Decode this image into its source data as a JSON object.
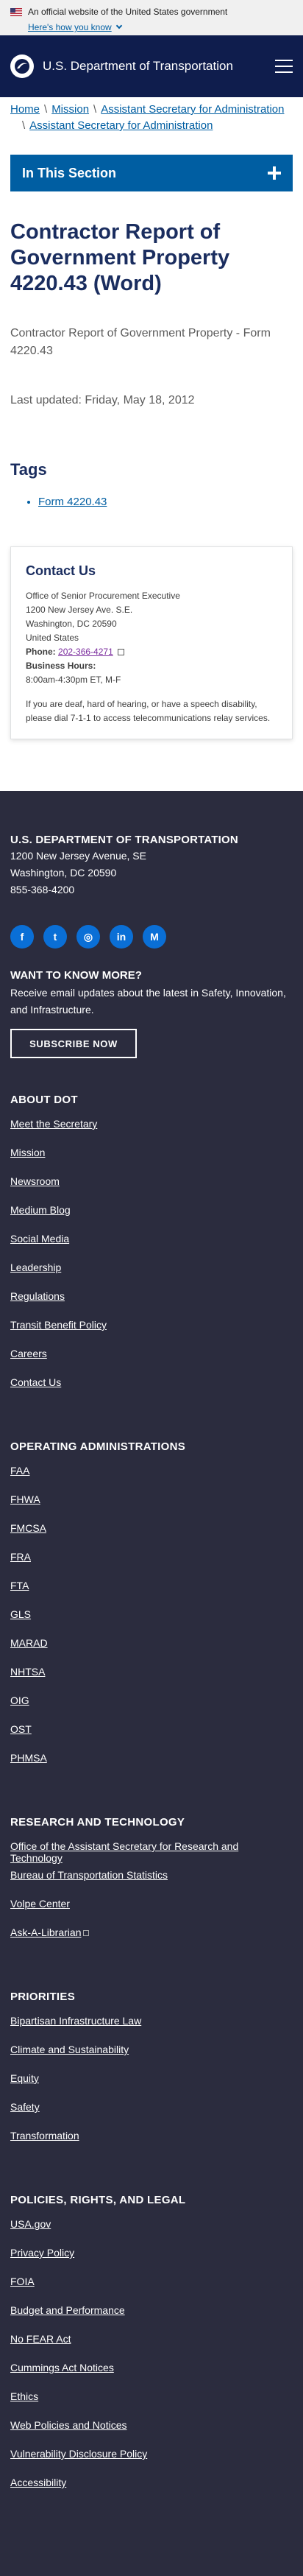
{
  "banner": {
    "official_text": "An official website of the United States government",
    "how_link": "Here's how you know"
  },
  "header": {
    "title": "U.S. Department of Transportation"
  },
  "breadcrumb": {
    "items": [
      "Home",
      "Mission",
      "Assistant Secretary for Administration",
      "Assistant Secretary for Administration"
    ]
  },
  "section_toggle": {
    "label": "In This Section"
  },
  "main": {
    "title": "Contractor Report of Government Property 4220.43 (Word)",
    "summary": "Contractor Report of Government Property - Form 4220.43",
    "last_updated": "Last updated: Friday, May 18, 2012",
    "tags_heading": "Tags",
    "tags": [
      "Form 4220.43"
    ]
  },
  "contact": {
    "heading": "Contact Us",
    "office": "Office of Senior Procurement Executive",
    "street": "1200 New Jersey Ave. S.E.",
    "city": "Washington, DC 20590",
    "country": "United States",
    "phone_label": "Phone:",
    "phone": "202-366-4271",
    "hours_label": "Business Hours:",
    "hours": "8:00am-4:30pm ET, M-F",
    "note": "If you are deaf, hard of hearing, or have a speech disability, please dial 7-1-1 to access telecommunications relay services."
  },
  "footer": {
    "org": "U.S. DEPARTMENT OF TRANSPORTATION",
    "address_line1": "1200 New Jersey Avenue, SE",
    "address_line2": "Washington, DC 20590",
    "phone": "855-368-4200",
    "socials": [
      {
        "name": "facebook-icon",
        "glyph": "f"
      },
      {
        "name": "twitter-icon",
        "glyph": "t"
      },
      {
        "name": "instagram-icon",
        "glyph": "◎"
      },
      {
        "name": "linkedin-icon",
        "glyph": "in"
      },
      {
        "name": "medium-icon",
        "glyph": "M"
      }
    ],
    "want_heading": "WANT TO KNOW MORE?",
    "want_text": "Receive email updates about the latest in Safety, Innovation, and Infrastructure.",
    "subscribe_label": "SUBSCRIBE NOW",
    "sections": [
      {
        "heading": "ABOUT DOT",
        "links": [
          "Meet the Secretary",
          "Mission",
          "Newsroom",
          "Medium Blog",
          "Social Media",
          "Leadership",
          "Regulations",
          "Transit Benefit Policy",
          "Careers",
          "Contact Us"
        ]
      },
      {
        "heading": "OPERATING ADMINISTRATIONS",
        "links": [
          "FAA",
          "FHWA",
          "FMCSA",
          "FRA",
          "FTA",
          "GLS",
          "MARAD",
          "NHTSA",
          "OIG",
          "OST",
          "PHMSA"
        ]
      },
      {
        "heading": "RESEARCH AND TECHNOLOGY",
        "links": [
          "Office of the Assistant Secretary for Research and Technology",
          "Bureau of Transportation Statistics",
          "Volpe Center",
          "Ask-A-Librarian"
        ]
      },
      {
        "heading": "PRIORITIES",
        "links": [
          "Bipartisan Infrastructure Law",
          "Climate and Sustainability",
          "Equity",
          "Safety",
          "Transformation"
        ]
      },
      {
        "heading": "POLICIES, RIGHTS, AND LEGAL",
        "links": [
          "USA.gov",
          "Privacy Policy",
          "FOIA",
          "Budget and Performance",
          "No FEAR Act",
          "Cummings Act Notices",
          "Ethics",
          "Web Policies and Notices",
          "Vulnerability Disclosure Policy",
          "Accessibility"
        ]
      }
    ]
  }
}
